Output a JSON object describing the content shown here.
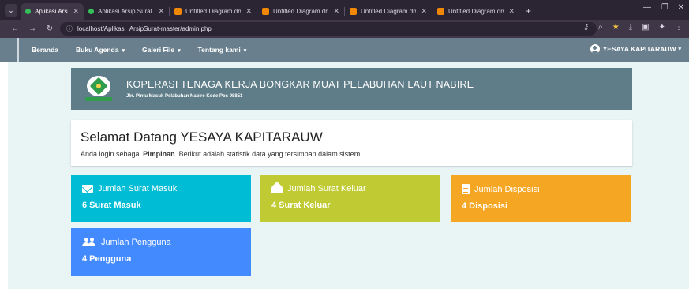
{
  "browser": {
    "tabs": [
      {
        "label": "Aplikasi Arsip Surat",
        "icon": "green-dot-favicon",
        "active": true
      },
      {
        "label": "Aplikasi Arsip Surat",
        "icon": "green-dot-favicon",
        "active": false
      },
      {
        "label": "Untitled Diagram.drw",
        "icon": "drawio-favicon",
        "active": false
      },
      {
        "label": "Untitled Diagram.drw",
        "icon": "drawio-favicon",
        "active": false
      },
      {
        "label": "Untitled Diagram.drw",
        "icon": "drawio-favicon",
        "active": false
      },
      {
        "label": "Untitled Diagram.drw",
        "icon": "drawio-favicon",
        "active": false
      }
    ],
    "url": "localhost/Aplikasi_ArsipSurat-master/admin.php"
  },
  "navbar": {
    "items": [
      {
        "label": "Beranda",
        "dropdown": false
      },
      {
        "label": "Buku Agenda",
        "dropdown": true
      },
      {
        "label": "Galeri File",
        "dropdown": true
      },
      {
        "label": "Tentang kami",
        "dropdown": true
      }
    ],
    "user": "YESAYA KAPITARAUW"
  },
  "header": {
    "title": "KOPERASI TENAGA KERJA BONGKAR MUAT PELABUHAN LAUT NABIRE",
    "subtitle": "Jln. Pintu Masuk Pelabuhan Nabire Kode Pos 98851"
  },
  "welcome": {
    "title": "Selamat Datang YESAYA KAPITARAUW",
    "text_prefix": "Anda login sebagai ",
    "role": "Pimpinan",
    "text_suffix": ". Berikut adalah statistik data yang tersimpan dalam sistem."
  },
  "stats": [
    {
      "title": "Jumlah Surat Masuk",
      "value": "6 Surat Masuk",
      "color": "#00bcd4",
      "icon": "mail-icon"
    },
    {
      "title": "Jumlah Surat Keluar",
      "value": "4 Surat Keluar",
      "color": "#c0ca33",
      "icon": "drafts-icon"
    },
    {
      "title": "Jumlah Disposisi",
      "value": "4 Disposisi",
      "color": "#f5a623",
      "icon": "description-icon"
    },
    {
      "title": "Jumlah Pengguna",
      "value": "4 Pengguna",
      "color": "#448aff",
      "icon": "people-icon"
    }
  ],
  "theme": {
    "navbar": "#697f8d",
    "header": "#5f7d89",
    "page_bg": "#e9f4f5"
  }
}
